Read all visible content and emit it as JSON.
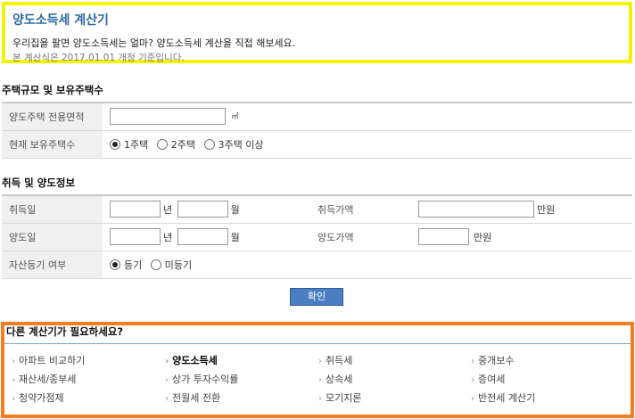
{
  "header": {
    "title": "양도소득세 계산기",
    "description": "우리집을 팔면 양도소득세는 얼마? 양도소득세 계산을 직접 해보세요.",
    "note": "본 계산식은 2017.01.01 개정 기준입니다."
  },
  "section1": {
    "title": "주택규모 및 보유주택수",
    "area_label": "양도주택 전용면적",
    "area_unit": "㎡",
    "count_label": "현재 보유주택수",
    "count_options": [
      "1주택",
      "2주택",
      "3주택 이상"
    ],
    "count_selected": "1주택"
  },
  "section2": {
    "title": "취득 및 양도정보",
    "acq_date_label": "취득일",
    "acq_price_label": "취득가액",
    "sale_date_label": "양도일",
    "sale_price_label": "양도가액",
    "year_unit": "년",
    "month_unit": "월",
    "won_unit_1": "만원",
    "won_unit_2": "만원",
    "reg_label": "자산등기 여부",
    "reg_options": [
      "등기",
      "미등기"
    ],
    "reg_selected": "등기"
  },
  "confirm_label": "확인",
  "other": {
    "title": "다른 계산기가 필요하세요?",
    "links": [
      {
        "label": "아파트 비교하기",
        "active": false
      },
      {
        "label": "양도소득세",
        "active": true
      },
      {
        "label": "취득세",
        "active": false
      },
      {
        "label": "중개보수",
        "active": false
      },
      {
        "label": "재산세/종부세",
        "active": false
      },
      {
        "label": "상가 투자수익률",
        "active": false
      },
      {
        "label": "상속세",
        "active": false
      },
      {
        "label": "증여세",
        "active": false
      },
      {
        "label": "청약가점제",
        "active": false
      },
      {
        "label": "전월세 전환",
        "active": false
      },
      {
        "label": "모기지론",
        "active": false
      },
      {
        "label": "반전세 계산기",
        "active": false
      }
    ]
  },
  "colors": {
    "header_border": "#f2f20a",
    "other_border": "#f47d20",
    "title_blue": "#2d68a8",
    "button": "#4b7ec0"
  }
}
